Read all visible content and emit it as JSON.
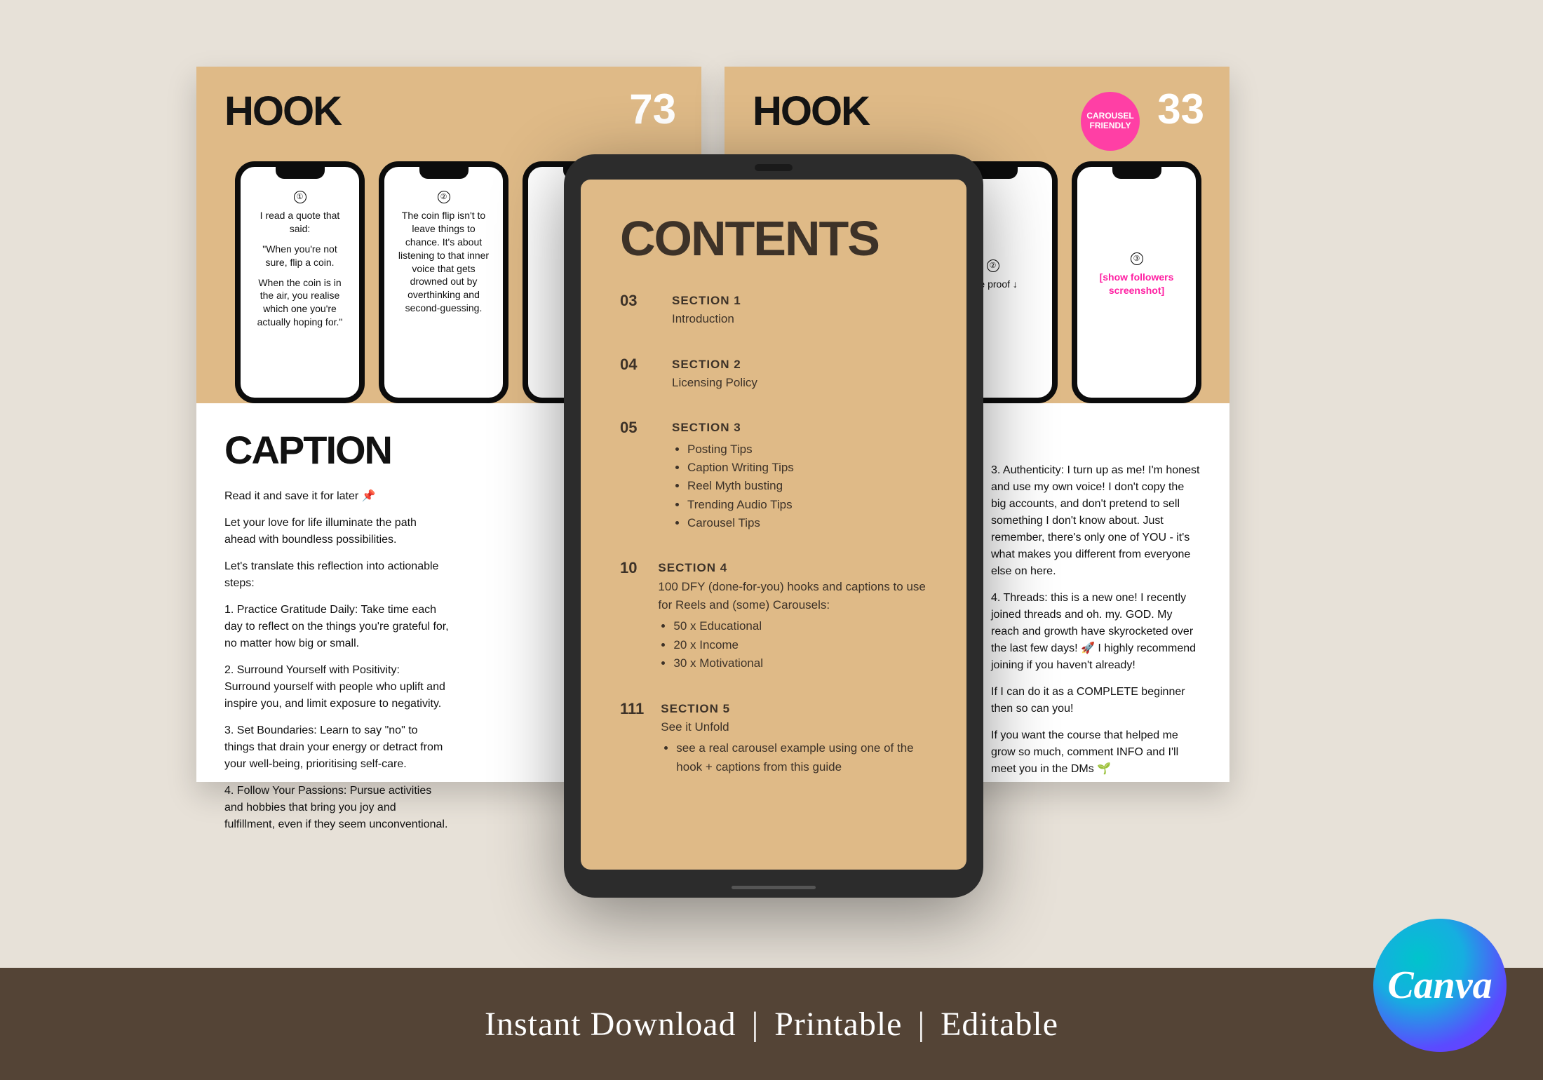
{
  "left": {
    "hook_label": "HOOK",
    "hook_num": "73",
    "phone1": {
      "idx": "①",
      "l1": "I read a quote that said:",
      "l2": "\"When you're not sure, flip a coin.",
      "l3": "When the coin is in the air, you realise which one you're actually hoping for.\""
    },
    "phone2": {
      "idx": "②",
      "l1": "The coin flip isn't to leave things to chance. It's about listening to that inner voice that gets drowned out by overthinking and second-guessing."
    },
    "caption_title": "CAPTION",
    "p0": "Read it and save it for later 📌",
    "p1": "Let your love for life illuminate the path ahead with boundless possibilities.",
    "p2": "Let's translate this reflection into actionable steps:",
    "p3": "1. Practice Gratitude Daily: Take time each day to reflect on the things you're grateful for, no matter how big or small.",
    "p4": "2. Surround Yourself with Positivity: Surround yourself with people who uplift and inspire you, and limit exposure to negativity.",
    "p5": "3. Set Boundaries: Learn to say \"no\" to things that drain your energy or detract from your well-being, prioritising self-care.",
    "p6": "4. Follow Your Passions: Pursue activities and hobbies that bring you joy and fulfillment, even if they seem unconventional."
  },
  "right": {
    "hook_label": "HOOK",
    "hook_num": "33",
    "seal": "CAROUSEL FRIENDLY",
    "phone2": {
      "idx": "②",
      "l1": "The proof ↓"
    },
    "phone3": {
      "idx": "③",
      "l1": "[show followers screenshot]"
    },
    "p1": "3. Authenticity: I turn up as me! I'm honest and use my own voice! I don't copy the big accounts, and don't pretend to sell something I don't know about. Just remember, there's only one of YOU - it's what makes you different from everyone else on here.",
    "p2": "4. Threads: this is a new one! I recently joined threads and oh. my. GOD. My reach and growth have skyrocketed over the last few days! 🚀 I highly recommend joining if you haven't already!",
    "p3": "If I can do it as a COMPLETE beginner then so can you!",
    "p4": "If you want the course that helped me grow so much, comment INFO and I'll meet you in the DMs 🌱"
  },
  "tablet": {
    "title": "CONTENTS",
    "rows": [
      {
        "num": "03",
        "heading": "SECTION 1",
        "desc": "Introduction"
      },
      {
        "num": "04",
        "heading": "SECTION 2",
        "desc": "Licensing Policy"
      },
      {
        "num": "05",
        "heading": "SECTION 3",
        "bullets": [
          "Posting Tips",
          "Caption Writing Tips",
          "Reel Myth busting",
          "Trending Audio Tips",
          "Carousel Tips"
        ]
      },
      {
        "num": "10",
        "heading": "SECTION 4",
        "desc": "100 DFY (done-for-you) hooks and captions to use for Reels and (some) Carousels:",
        "bullets": [
          "50 x Educational",
          "20 x Income",
          "30 x Motivational"
        ]
      },
      {
        "num": "111",
        "heading": "SECTION 5",
        "desc": "See it Unfold",
        "bullets": [
          "see a real carousel example using one of the hook + captions from this guide"
        ]
      }
    ]
  },
  "footer": {
    "a": "Instant Download",
    "b": "Printable",
    "c": "Editable"
  },
  "canva": "Canva"
}
